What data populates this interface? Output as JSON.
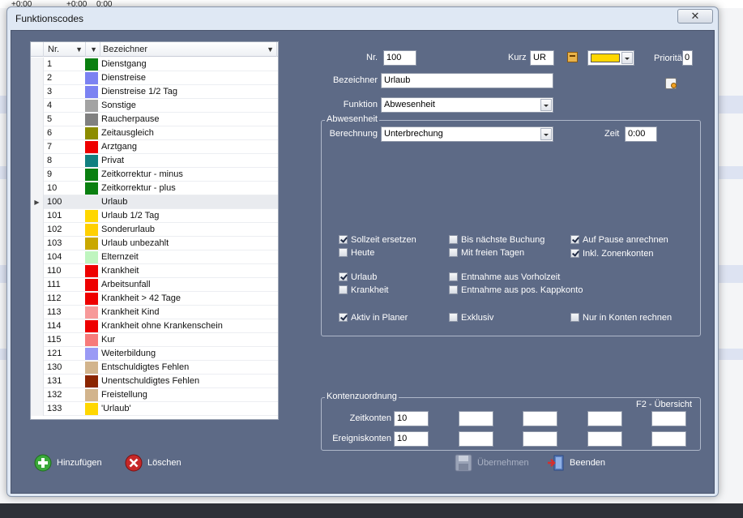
{
  "background": {
    "top_cells": [
      "+0:00",
      "+0:00",
      "0:00"
    ]
  },
  "window": {
    "title": "Funktionscodes",
    "close_label": "✕"
  },
  "list": {
    "columns": {
      "nr": "Nr.",
      "bezeichner": "Bezeichner"
    },
    "selected_index": 11,
    "rows": [
      {
        "nr": "1",
        "name": "Dienstgang",
        "color": "#0a7f10"
      },
      {
        "nr": "2",
        "name": "Dienstreise",
        "color": "#7b82f2"
      },
      {
        "nr": "3",
        "name": "Dienstreise 1/2 Tag",
        "color": "#7b82f2"
      },
      {
        "nr": "4",
        "name": "Sonstige",
        "color": "#a3a3a3"
      },
      {
        "nr": "5",
        "name": "Raucherpause",
        "color": "#808080"
      },
      {
        "nr": "6",
        "name": "Zeitausgleich",
        "color": "#8c8c00"
      },
      {
        "nr": "7",
        "name": "Arztgang",
        "color": "#ee0000"
      },
      {
        "nr": "8",
        "name": "Privat",
        "color": "#118080"
      },
      {
        "nr": "9",
        "name": "Zeitkorrektur - minus",
        "color": "#0a7f10"
      },
      {
        "nr": "10",
        "name": "Zeitkorrektur - plus",
        "color": "#0a7f10"
      },
      {
        "nr": "100",
        "name": "Urlaub",
        "color": ""
      },
      {
        "nr": "101",
        "name": "Urlaub 1/2 Tag",
        "color": "#ffd700"
      },
      {
        "nr": "102",
        "name": "Sonderurlaub",
        "color": "#ffd000"
      },
      {
        "nr": "103",
        "name": "Urlaub unbezahlt",
        "color": "#c9a800"
      },
      {
        "nr": "104",
        "name": "Elternzeit",
        "color": "#bff5bf"
      },
      {
        "nr": "110",
        "name": "Krankheit",
        "color": "#ee0000"
      },
      {
        "nr": "111",
        "name": "Arbeitsunfall",
        "color": "#ee0000"
      },
      {
        "nr": "112",
        "name": "Krankheit > 42 Tage",
        "color": "#ee0000"
      },
      {
        "nr": "113",
        "name": "Krankheit Kind",
        "color": "#f79999"
      },
      {
        "nr": "114",
        "name": "Krankheit ohne Krankenschein",
        "color": "#ee0000"
      },
      {
        "nr": "115",
        "name": "Kur",
        "color": "#f77a7a"
      },
      {
        "nr": "121",
        "name": "Weiterbildung",
        "color": "#9a9af5"
      },
      {
        "nr": "130",
        "name": "Entschuldigtes Fehlen",
        "color": "#d2b48c"
      },
      {
        "nr": "131",
        "name": "Unentschuldigtes Fehlen",
        "color": "#8b2500"
      },
      {
        "nr": "132",
        "name": "Freistellung",
        "color": "#d2b48c"
      },
      {
        "nr": "133",
        "name": "'Urlaub'",
        "color": "#ffd700"
      }
    ]
  },
  "form": {
    "nr_label": "Nr.",
    "nr_value": "100",
    "kurz_label": "Kurz",
    "kurz_value": "UR",
    "color_value": "#ffd700",
    "prioritaet_label": "Priorität",
    "prioritaet_value": "0",
    "bezeichner_label": "Bezeichner",
    "bezeichner_value": "Urlaub",
    "funktion_label": "Funktion",
    "funktion_value": "Abwesenheit"
  },
  "abwesenheit": {
    "title": "Abwesenheit",
    "berechnung_label": "Berechnung",
    "berechnung_value": "Unterbrechung",
    "zeit_label": "Zeit",
    "zeit_value": "0:00",
    "checkboxes": {
      "sollzeit": {
        "label": "Sollzeit ersetzen",
        "checked": true
      },
      "heute": {
        "label": "Heute",
        "checked": false
      },
      "bis_buchung": {
        "label": "Bis nächste Buchung",
        "checked": false
      },
      "freie_tage": {
        "label": "Mit freien Tagen",
        "checked": false
      },
      "pause": {
        "label": "Auf Pause anrechnen",
        "checked": true
      },
      "zonenkonten": {
        "label": "Inkl. Zonenkonten",
        "checked": true
      },
      "urlaub": {
        "label": "Urlaub",
        "checked": true
      },
      "krankheit": {
        "label": "Krankheit",
        "checked": false
      },
      "vorholzeit": {
        "label": "Entnahme aus Vorholzeit",
        "checked": false
      },
      "kappkonto": {
        "label": "Entnahme aus pos. Kappkonto",
        "checked": false
      },
      "planer": {
        "label": "Aktiv in Planer",
        "checked": true
      },
      "exklusiv": {
        "label": "Exklusiv",
        "checked": false
      },
      "nur_konten": {
        "label": "Nur in Konten rechnen",
        "checked": false
      }
    }
  },
  "konten": {
    "title": "Kontenzuordnung",
    "hint": "F2 - Übersicht",
    "zeitkonten_label": "Zeitkonten",
    "ereigniskonten_label": "Ereigniskonten",
    "zeitkonten": [
      "10",
      "",
      "",
      "",
      ""
    ],
    "ereigniskonten": [
      "10",
      "",
      "",
      "",
      ""
    ]
  },
  "buttons": {
    "add": "Hinzufügen",
    "delete": "Löschen",
    "apply": "Übernehmen",
    "close": "Beenden"
  }
}
